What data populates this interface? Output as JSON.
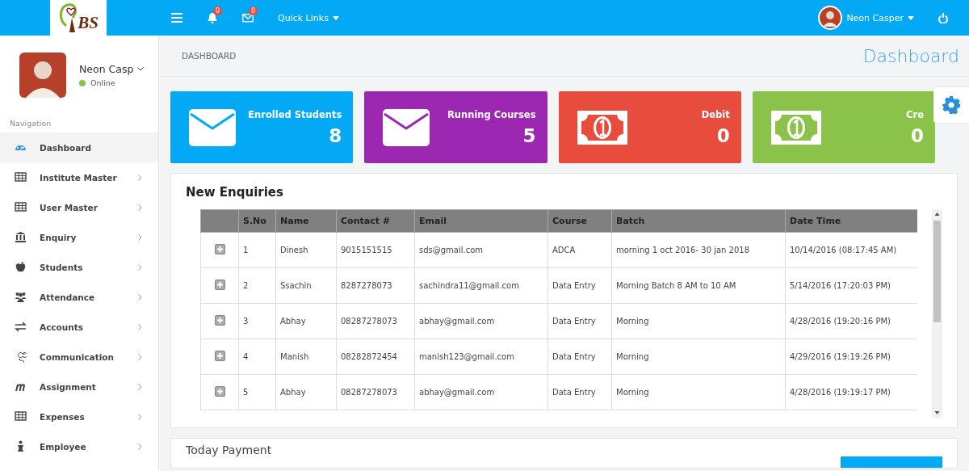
{
  "topbar": {
    "logo_text": "BS",
    "notifications": {
      "count": "0"
    },
    "messages": {
      "count": "0"
    },
    "quick_links": "Quick Links",
    "user_name": "Neon Casper"
  },
  "profile": {
    "name": "Neon Casp",
    "status": "Online"
  },
  "sidebar": {
    "heading": "Navigation",
    "items": [
      {
        "label": "Dashboard",
        "kind": "dashboard",
        "selected": true,
        "expandable": false
      },
      {
        "label": "Institute Master",
        "kind": "table",
        "selected": false,
        "expandable": true
      },
      {
        "label": "User Master",
        "kind": "table",
        "selected": false,
        "expandable": true
      },
      {
        "label": "Enquiry",
        "kind": "bank",
        "selected": false,
        "expandable": true
      },
      {
        "label": "Students",
        "kind": "apple",
        "selected": false,
        "expandable": true
      },
      {
        "label": "Attendance",
        "kind": "users",
        "selected": false,
        "expandable": true
      },
      {
        "label": "Accounts",
        "kind": "exchange",
        "selected": false,
        "expandable": true
      },
      {
        "label": "Communication",
        "kind": "glyph-g",
        "selected": false,
        "expandable": true
      },
      {
        "label": "Assignment",
        "kind": "glyph-m",
        "selected": false,
        "expandable": true
      },
      {
        "label": "Expenses",
        "kind": "table",
        "selected": false,
        "expandable": true
      },
      {
        "label": "Employee",
        "kind": "person",
        "selected": false,
        "expandable": true
      }
    ]
  },
  "breadcrumb": "DASHBOARD",
  "page_title": "Dashboard",
  "stats": [
    {
      "label": "Enrolled Students",
      "value": "8",
      "color": "#03a9f4",
      "kind": "envelope"
    },
    {
      "label": "Running Courses",
      "value": "5",
      "color": "#9c27b0",
      "kind": "envelope"
    },
    {
      "label": "Debit",
      "value": "0",
      "color": "#e74c3c",
      "kind": "money"
    },
    {
      "label": "Cre",
      "value": "0",
      "color": "#8bc34a",
      "kind": "money"
    }
  ],
  "enquiries": {
    "title": "New Enquiries",
    "columns": [
      "S.No",
      "Name",
      "Contact #",
      "Email",
      "Course",
      "Batch",
      "Date Time"
    ],
    "rows": [
      [
        "1",
        "Dinesh",
        "9015151515",
        "sds@gmail.com",
        "ADCA",
        "morning 1 oct 2016- 30 jan 2018",
        "10/14/2016 (08:17:45 AM)"
      ],
      [
        "2",
        "Ssachin",
        "8287278073",
        "sachindra11@gmail.com",
        "Data Entry",
        "Morning Batch 8 AM to 10 AM",
        "5/14/2016 (17:20:03 PM)"
      ],
      [
        "3",
        "Abhay",
        "08287278073",
        "abhay@gmail.com",
        "Data Entry",
        "Morning",
        "4/28/2016 (19:20:16 PM)"
      ],
      [
        "4",
        "Manish",
        "08282872454",
        "manish123@gmail.com",
        "Data Entry",
        "Morning",
        "4/29/2016 (19:19:26 PM)"
      ],
      [
        "5",
        "Abhay",
        "08287278073",
        "abhay@gmail.com",
        "Data Entry",
        "Morning",
        "4/28/2016 (19:19:17 PM)"
      ]
    ]
  },
  "payment": {
    "title": "Today Payment"
  }
}
